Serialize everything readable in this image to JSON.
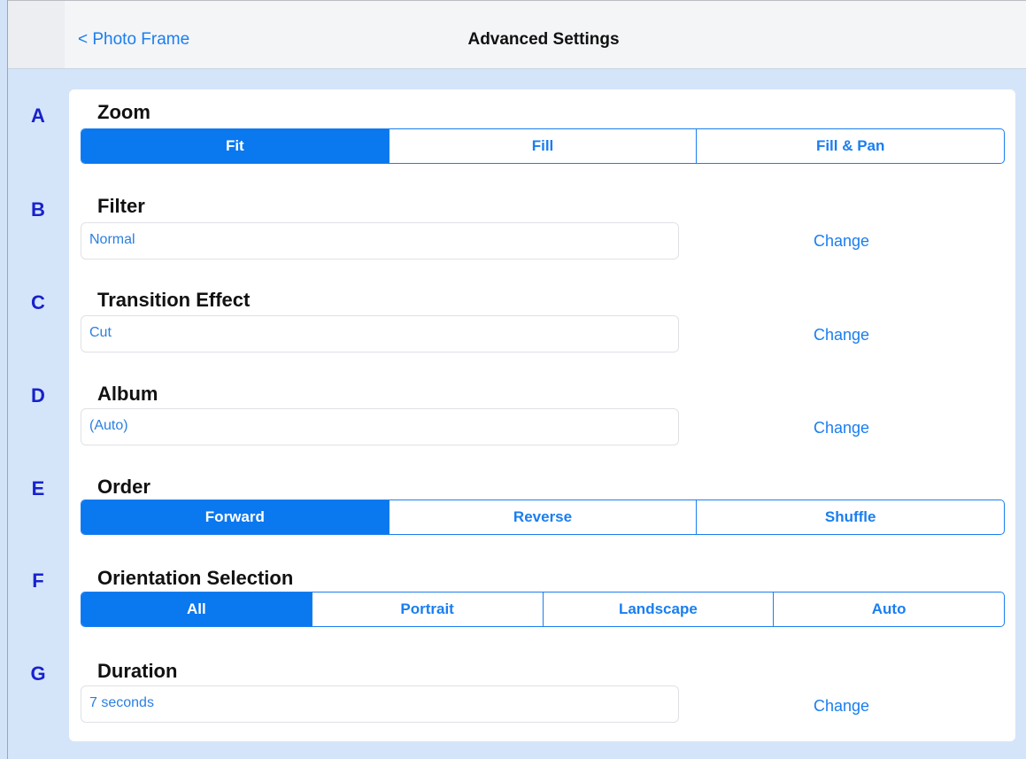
{
  "nav": {
    "back_label": "< Photo Frame",
    "title": "Advanced Settings"
  },
  "sections": {
    "zoom": {
      "letter": "A",
      "title": "Zoom",
      "options": [
        "Fit",
        "Fill",
        "Fill & Pan"
      ],
      "selected": "Fit"
    },
    "filter": {
      "letter": "B",
      "title": "Filter",
      "value": "Normal",
      "action": "Change"
    },
    "transition": {
      "letter": "C",
      "title": "Transition Effect",
      "value": "Cut",
      "action": "Change"
    },
    "album": {
      "letter": "D",
      "title": "Album",
      "value": "(Auto)",
      "action": "Change"
    },
    "order": {
      "letter": "E",
      "title": "Order",
      "options": [
        "Forward",
        "Reverse",
        "Shuffle"
      ],
      "selected": "Forward"
    },
    "orientation": {
      "letter": "F",
      "title": "Orientation Selection",
      "options": [
        "All",
        "Portrait",
        "Landscape",
        "Auto"
      ],
      "selected": "All"
    },
    "duration": {
      "letter": "G",
      "title": "Duration",
      "value": "7 seconds",
      "action": "Change"
    }
  },
  "colors": {
    "accent": "#0a78ee",
    "letter": "#1822cc",
    "background": "#d5e5f9"
  }
}
